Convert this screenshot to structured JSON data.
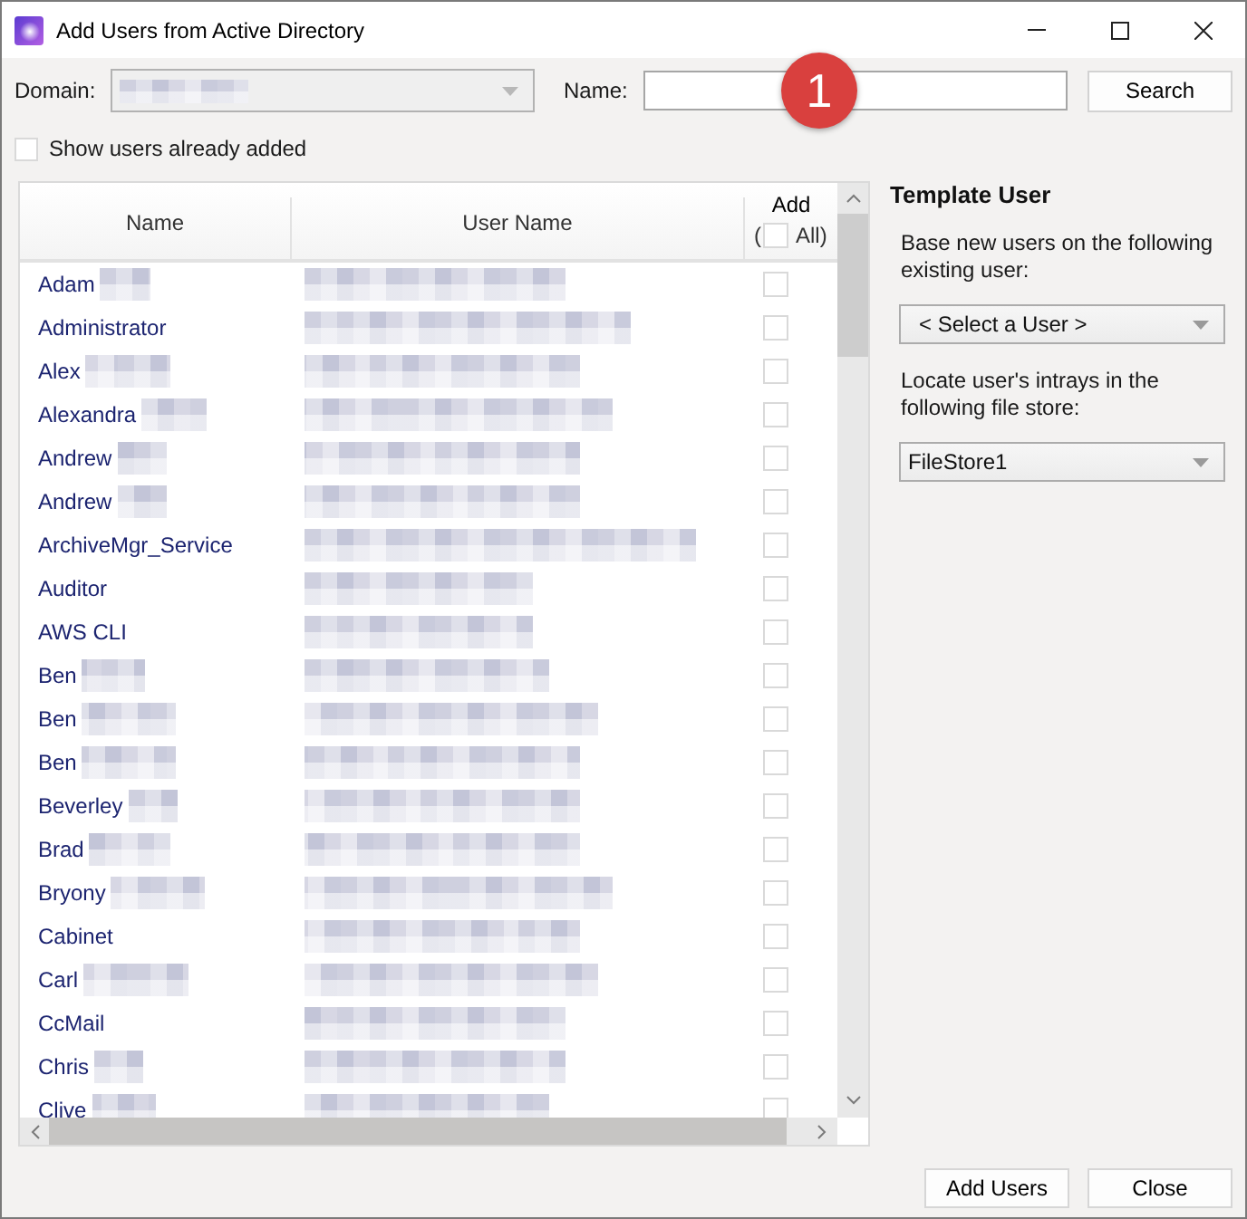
{
  "window": {
    "title": "Add Users from Active Directory"
  },
  "toolbar": {
    "domain": {
      "label": "Domain:",
      "disabled": true,
      "value_blurred": true
    },
    "name": {
      "label": "Name:"
    },
    "search_button": "Search"
  },
  "annotation": {
    "text": "1"
  },
  "show_added": {
    "label": "Show users already added",
    "checked": false
  },
  "table": {
    "columns": [
      "Name",
      "User Name",
      "Add"
    ],
    "add_all": {
      "prefix": "(",
      "label": "All)",
      "checked": false
    },
    "rows": [
      {
        "name": "Adam",
        "surname_blurred": true,
        "username_blurred": true,
        "add": false
      },
      {
        "name": "Administrator",
        "surname_blurred": false,
        "username_blurred": true,
        "add": false
      },
      {
        "name": "Alex",
        "surname_blurred": true,
        "username_blurred": true,
        "add": false
      },
      {
        "name": "Alexandra",
        "surname_blurred": true,
        "username_blurred": true,
        "add": false
      },
      {
        "name": "Andrew",
        "surname_blurred": true,
        "username_blurred": true,
        "add": false
      },
      {
        "name": "Andrew",
        "surname_blurred": true,
        "username_blurred": true,
        "add": false
      },
      {
        "name": "ArchiveMgr_Service",
        "surname_blurred": false,
        "username_blurred": true,
        "add": false
      },
      {
        "name": "Auditor",
        "surname_blurred": false,
        "username_blurred": true,
        "add": false
      },
      {
        "name": "AWS CLI",
        "surname_blurred": false,
        "username_blurred": true,
        "add": false
      },
      {
        "name": "Ben",
        "surname_blurred": true,
        "username_blurred": true,
        "add": false
      },
      {
        "name": "Ben",
        "surname_blurred": true,
        "username_blurred": true,
        "add": false
      },
      {
        "name": "Ben",
        "surname_blurred": true,
        "username_blurred": true,
        "add": false
      },
      {
        "name": "Beverley",
        "surname_blurred": true,
        "username_blurred": true,
        "add": false
      },
      {
        "name": "Brad",
        "surname_blurred": true,
        "username_blurred": true,
        "add": false
      },
      {
        "name": "Bryony",
        "surname_blurred": true,
        "username_blurred": true,
        "add": false
      },
      {
        "name": "Cabinet",
        "surname_blurred": false,
        "username_blurred": true,
        "add": false
      },
      {
        "name": "Carl",
        "surname_blurred": true,
        "username_blurred": true,
        "add": false
      },
      {
        "name": "CcMail",
        "surname_blurred": false,
        "username_blurred": true,
        "add": false
      },
      {
        "name": "Chris",
        "surname_blurred": true,
        "username_blurred": true,
        "add": false
      },
      {
        "name": "Clive",
        "surname_blurred": true,
        "username_blurred": true,
        "add": false
      }
    ]
  },
  "template_user": {
    "title": "Template User",
    "user_prompt": "Base new users on the following existing user:",
    "user_select": "< Select a User >",
    "store_prompt": "Locate user's intrays in the following file store:",
    "store_select": "FileStore1"
  },
  "buttons": [
    "Add Users",
    "Close"
  ]
}
